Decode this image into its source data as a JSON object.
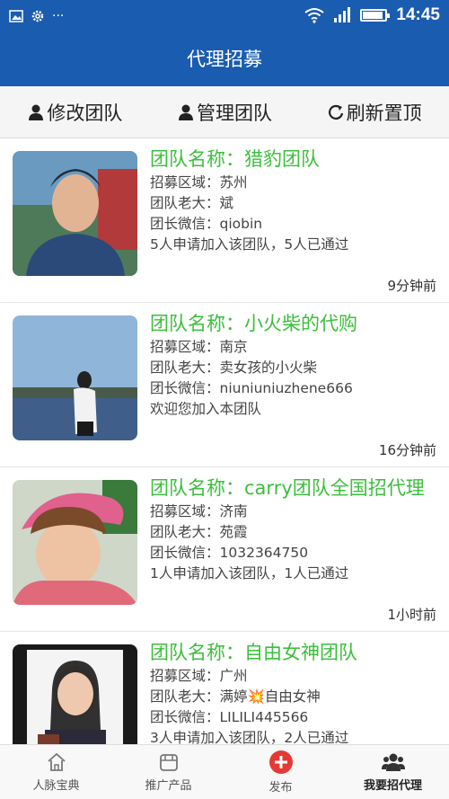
{
  "status_bar": {
    "time": "14:45",
    "dots": "···"
  },
  "title": "代理招募",
  "toolbar": {
    "edit_team": "修改团队",
    "manage_team": "管理团队",
    "refresh_top": "刷新置顶"
  },
  "teams": [
    {
      "name": "团队名称：猎豹团队",
      "region": "招募区域：苏州",
      "leader": "团队老大：斌",
      "wechat": "团长微信：qiobin",
      "note": "5人申请加入该团队，5人已通过",
      "time": "9分钟前"
    },
    {
      "name": "团队名称：小火柴的代购",
      "region": "招募区域：南京",
      "leader": "团队老大：卖女孩的小火柴",
      "wechat": "团长微信：niuniuniuzhene666",
      "note": "欢迎您加入本团队",
      "time": "16分钟前"
    },
    {
      "name": "团队名称：carry团队全国招代理",
      "region": "招募区域：济南",
      "leader": "团队老大：苑霞",
      "wechat": "团长微信：1032364750",
      "note": "1人申请加入该团队，1人已通过",
      "time": "1小时前"
    },
    {
      "name": "团队名称：自由女神团队",
      "region": "招募区域：广州",
      "leader": "团队老大：满婷💥自由女神",
      "wechat": "团长微信：LILILI445566",
      "note": "3人申请加入该团队，2人已通过",
      "time": ""
    }
  ],
  "bottom_nav": {
    "items": [
      {
        "label": "人脉宝典",
        "icon": "house-icon"
      },
      {
        "label": "推广产品",
        "icon": "box-icon"
      },
      {
        "label": "发布",
        "icon": "plus-circle-icon"
      },
      {
        "label": "我要招代理",
        "icon": "people-icon"
      }
    ]
  },
  "colors": {
    "header_blue": "#1a5cb0",
    "team_name_green": "#3cbf3c",
    "publish_red": "#e53935"
  }
}
